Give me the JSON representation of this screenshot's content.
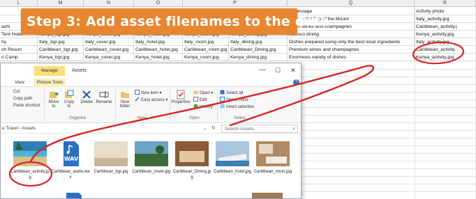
{
  "sheet": {
    "columns": [
      {
        "letter": "L",
        "x": 0
      },
      {
        "letter": "M",
        "x": 0
      },
      {
        "letter": "N",
        "x": 0
      },
      {
        "letter": "O",
        "x": 0
      },
      {
        "letter": "P",
        "x": 0
      },
      {
        "letter": "Q",
        "x": 0
      },
      {
        "letter": "R",
        "x": 0
      }
    ],
    "rows": [
      [
        "",
        "",
        "",
        "",
        "",
        "g message",
        "Activity photo"
      ],
      [
        "",
        "",
        "",
        "",
        "",
        "ining at the Top of the Mount",
        "Italy_activity.jpg"
      ],
      [
        "achi",
        "",
        "",
        "",
        "",
        "mium wines and champagnes",
        "Caribbean_activity.j"
      ],
      [
        "Tent Hotel",
        "Kenya_bgr.jpg",
        "Kenya_cover.jpg",
        "Kenya_hotel.jpg",
        "Kenya_room.jpg",
        "Kenya_dining.jpg",
        "Afresco dining",
        "Kenya_activity.jpg"
      ],
      [
        "hy",
        "Italy_bgr.jpg",
        "Italy_cover.jpg",
        "Italy_hotel.jpg",
        "Italy_room.jpg",
        "Italy_dining.jpg",
        "Dishes prepared using only the best local ingredients",
        "Italy_activity.jpg"
      ],
      [
        "ch Resort",
        "Caribbean_bgr.jpg",
        "Caribbean_cover.jpg",
        "Caribbean_hotel.jpg",
        "Caribbean_room.jpg",
        "Caribbean_Dining.jpg",
        "Premium wines and champagnes",
        "Caribbean_activity."
      ],
      [
        "ri Camp",
        "Kenya_bgr.jpg",
        "Kenya_cover.jpg",
        "Kenya_hotel.jpg",
        "Kenya_room.jpg",
        "Kenya_dining.jpg",
        "Enormous variety of dishes",
        "Kenya_activity.jpg"
      ]
    ],
    "header_letters": [
      "L",
      "M",
      "N",
      "O",
      "P",
      "Q",
      "R"
    ]
  },
  "banner": {
    "text": "Step 3: Add asset filenames to the data"
  },
  "explorer": {
    "manage_tab": "Manage",
    "title": "Assets",
    "minimize": "—",
    "maximize": "☐",
    "close": "✕",
    "tabs": [
      "View",
      "Picture Tools"
    ],
    "help": "?",
    "ribbon": {
      "cut": "Cut",
      "copy_path": "Copy path",
      "paste_shortcut": "Paste shortcut",
      "move_to": "Move to",
      "copy_to": "Copy to",
      "delete": "Delete",
      "rename": "Rename",
      "new_folder": "New folder",
      "new_item": "New item",
      "easy_access": "Easy access",
      "properties": "Properties",
      "open": "Open",
      "edit": "Edit",
      "history": "History",
      "select_all": "Select all",
      "select_none": "Select none",
      "invert_selection": "Invert selection",
      "group_organize": "Organize",
      "group_new": "New",
      "group_open": "Open",
      "group_select": "Select"
    },
    "address": "e Travel  ›  Assets",
    "address_chevron": "⌄",
    "refresh": "↻",
    "search_placeholder": "Search Assets",
    "search_icon": "⌕",
    "files": [
      {
        "name": "Caribbean_activity.jpg",
        "thumb": "caribbean-beach-thumb",
        "color1": "#2f7fb8",
        "color2": "#d8c08a"
      },
      {
        "name": "Caribbean_audio.wav",
        "thumb": "wav-file-icon",
        "color1": "#2a6fc2",
        "color2": "#ffffff"
      },
      {
        "name": "Caribbean_bgr.jpg",
        "thumb": "caribbean-bgr-thumb",
        "color1": "#e9dcc8",
        "color2": "#c9b496"
      },
      {
        "name": "Caribbean_cover.jpg",
        "thumb": "caribbean-cover-thumb",
        "color1": "#6da3c4",
        "color2": "#3e6b3a"
      },
      {
        "name": "Caribbean_Dining.jpg",
        "thumb": "caribbean-dining-thumb",
        "color1": "#8a5a3a",
        "color2": "#e2c79d"
      },
      {
        "name": "Caribbean_hotel.jpg",
        "thumb": "caribbean-hotel-thumb",
        "color1": "#a9c6de",
        "color2": "#f2f2f2"
      },
      {
        "name": "Caribbean_room.jpg",
        "thumb": "caribbean-room-thumb",
        "color1": "#b08a64",
        "color2": "#e8d8c0"
      }
    ]
  },
  "colors": {
    "banner": "#e8852f",
    "annotation": "#d8231f",
    "manage_tab": "#f7e07a"
  }
}
